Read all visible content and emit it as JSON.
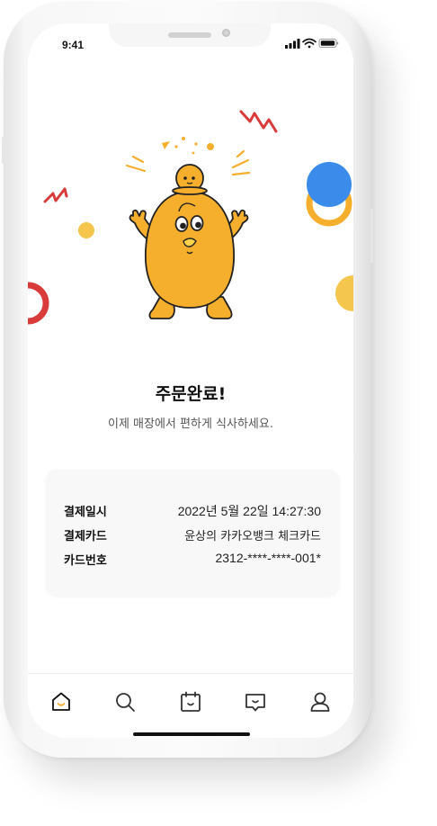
{
  "status_bar": {
    "time": "9:41"
  },
  "order": {
    "title": "주문완료!",
    "subtitle": "이제 매장에서 편하게 식사하세요."
  },
  "payment_details": {
    "rows": [
      {
        "label": "결제일시",
        "value": "2022년 5월 22일 14:27:30"
      },
      {
        "label": "결제카드",
        "value": "윤상의 카카오뱅크 체크카드"
      },
      {
        "label": "카드번호",
        "value": "2312-****-****-001*"
      }
    ]
  },
  "tab_bar": {
    "tabs": [
      {
        "icon": "home-icon",
        "active": true
      },
      {
        "icon": "search-icon",
        "active": false
      },
      {
        "icon": "calendar-icon",
        "active": false
      },
      {
        "icon": "chat-icon",
        "active": false
      },
      {
        "icon": "profile-icon",
        "active": false
      }
    ]
  },
  "colors": {
    "accent_yellow": "#F6AE2D",
    "confetti_red": "#D93A3A",
    "confetti_blue": "#3B8BEB",
    "text_primary": "#111111"
  }
}
